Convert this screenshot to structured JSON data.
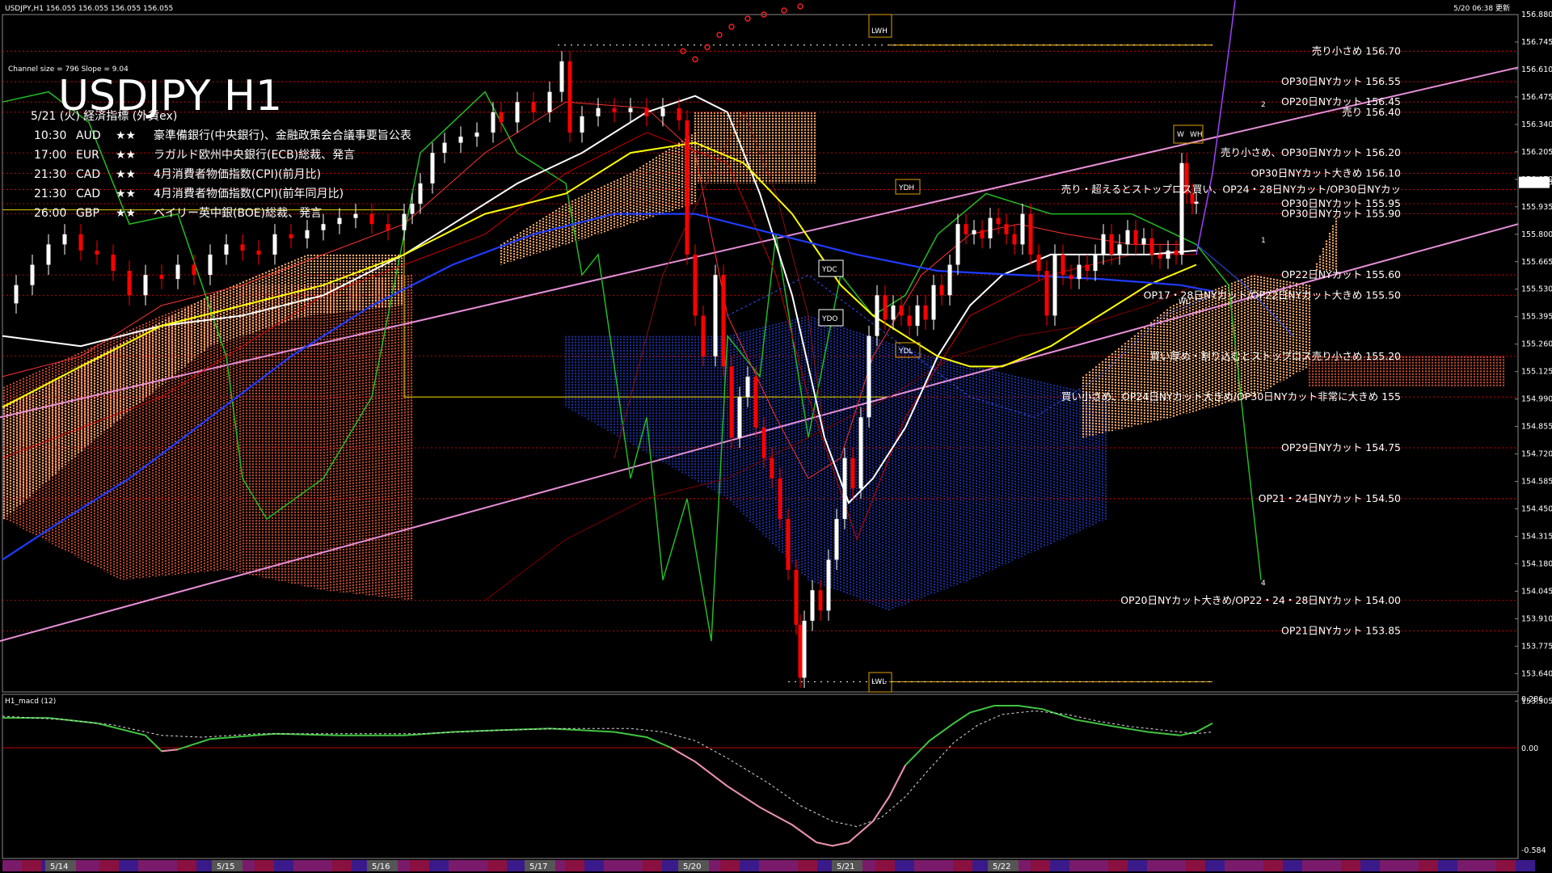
{
  "header": {
    "symbol_info": "USDJPY,H1  156.055 156.055 156.055 156.055",
    "timestamp": "5/20 06:38 更新",
    "channel_info": "Channel size = 796 Slope = 9.04",
    "title": "USDJPY H1"
  },
  "events": {
    "heading": "5/21 (火) 経済指標 (外貨ex)",
    "items": [
      {
        "time": "10:30",
        "currency": "AUD",
        "stars": "★★",
        "text": "豪準備銀行(中央銀行)、金融政策会合議事要旨公表"
      },
      {
        "time": "17:00",
        "currency": "EUR",
        "stars": "★★",
        "text": "ラガルド欧州中央銀行(ECB)総裁、発言"
      },
      {
        "time": "21:30",
        "currency": "CAD",
        "stars": "★★",
        "text": "4月消費者物価指数(CPI)(前月比)"
      },
      {
        "time": "21:30",
        "currency": "CAD",
        "stars": "★★",
        "text": "4月消費者物価指数(CPI)(前年同月比)"
      },
      {
        "time": "26:00",
        "currency": "GBP",
        "stars": "★★",
        "text": "ベイリー英中銀(BOE)総裁、発言"
      }
    ]
  },
  "markers": {
    "lwh": "LWH",
    "lwl": "LWL",
    "ydh": "YDH",
    "ydl": "YDL",
    "ydc": "YDC",
    "ydo": "YDO",
    "wh": "WH",
    "wl": "WL",
    "w": "W",
    "wave_1": "1",
    "wave_2": "2",
    "wave_4": "4"
  },
  "macd": {
    "label": "H1_macd (12)",
    "axis": [
      "0.286",
      "0.00",
      "-0.584"
    ],
    "main_points": [
      [
        3,
        0.17
      ],
      [
        60,
        0.17
      ],
      [
        120,
        0.14
      ],
      [
        180,
        0.07
      ],
      [
        200,
        -0.02
      ],
      [
        220,
        -0.01
      ],
      [
        260,
        0.05
      ],
      [
        340,
        0.08
      ],
      [
        420,
        0.07
      ],
      [
        500,
        0.07
      ],
      [
        560,
        0.09
      ],
      [
        620,
        0.1
      ],
      [
        680,
        0.11
      ],
      [
        760,
        0.09
      ],
      [
        800,
        0.06
      ],
      [
        830,
        0.0
      ],
      [
        860,
        -0.08
      ],
      [
        900,
        -0.22
      ],
      [
        940,
        -0.34
      ],
      [
        980,
        -0.44
      ],
      [
        1010,
        -0.54
      ],
      [
        1030,
        -0.56
      ],
      [
        1050,
        -0.54
      ],
      [
        1080,
        -0.42
      ],
      [
        1100,
        -0.28
      ],
      [
        1120,
        -0.1
      ],
      [
        1150,
        0.04
      ],
      [
        1180,
        0.14
      ],
      [
        1200,
        0.2
      ],
      [
        1230,
        0.24
      ],
      [
        1260,
        0.24
      ],
      [
        1290,
        0.22
      ],
      [
        1330,
        0.16
      ],
      [
        1380,
        0.12
      ],
      [
        1420,
        0.09
      ],
      [
        1460,
        0.07
      ],
      [
        1480,
        0.09
      ],
      [
        1500,
        0.14
      ]
    ],
    "signal_points": [
      [
        3,
        0.18
      ],
      [
        80,
        0.16
      ],
      [
        140,
        0.13
      ],
      [
        200,
        0.07
      ],
      [
        250,
        0.06
      ],
      [
        320,
        0.08
      ],
      [
        420,
        0.08
      ],
      [
        520,
        0.08
      ],
      [
        620,
        0.1
      ],
      [
        700,
        0.11
      ],
      [
        780,
        0.11
      ],
      [
        820,
        0.09
      ],
      [
        860,
        0.04
      ],
      [
        900,
        -0.06
      ],
      [
        950,
        -0.2
      ],
      [
        990,
        -0.33
      ],
      [
        1030,
        -0.42
      ],
      [
        1060,
        -0.45
      ],
      [
        1090,
        -0.4
      ],
      [
        1120,
        -0.28
      ],
      [
        1150,
        -0.12
      ],
      [
        1180,
        0.03
      ],
      [
        1210,
        0.13
      ],
      [
        1240,
        0.19
      ],
      [
        1280,
        0.21
      ],
      [
        1320,
        0.19
      ],
      [
        1360,
        0.15
      ],
      [
        1400,
        0.12
      ],
      [
        1440,
        0.1
      ],
      [
        1480,
        0.08
      ],
      [
        1500,
        0.09
      ]
    ]
  },
  "colors": {
    "background": "#000000",
    "bull": "#ffffff",
    "bear": "#ff0000",
    "cloud_bull": "#ffae6e",
    "cloud_bear": "#c04a30",
    "ma_short": "#ffffff",
    "ma_mid": "#ffff00",
    "ma_long": "#1f3cff",
    "channel": "#e88fd8",
    "chikou": "#22bb22",
    "level": "#ff0000"
  },
  "chart_data": {
    "type": "candlestick",
    "title": "USDJPY H1",
    "ylim": [
      153.55,
      156.88
    ],
    "y_ticks": [
      "156.880",
      "156.745",
      "156.610",
      "156.475",
      "156.340",
      "156.205",
      "156.070",
      "155.935",
      "155.800",
      "155.665",
      "155.530",
      "155.395",
      "155.260",
      "155.125",
      "154.990",
      "154.855",
      "154.720",
      "154.585",
      "154.450",
      "154.315",
      "154.180",
      "154.045",
      "153.910",
      "153.775",
      "153.640",
      "153.505"
    ],
    "current_price": "156.055",
    "x_labels": [
      "5/14",
      "5/15",
      "5/16",
      "5/17",
      "5/20",
      "5/21",
      "5/22"
    ],
    "levels": [
      {
        "label": "売り小さめ 156.70",
        "value": 156.7
      },
      {
        "label": "OP30日NYカット 156.55",
        "value": 156.55
      },
      {
        "label": "OP20日NYカット 156.45",
        "value": 156.45
      },
      {
        "label": "売り 156.40",
        "value": 156.4
      },
      {
        "label": "売り小さめ、OP30日NYカット 156.20",
        "value": 156.2
      },
      {
        "label": "OP30日NYカット大きめ 156.10",
        "value": 156.1
      },
      {
        "label": "売り・超えるとストップロス買い、OP24・28日NYカット/OP30日NYカッ",
        "value": 156.02
      },
      {
        "label": "OP30日NYカット 155.95",
        "value": 155.95
      },
      {
        "label": "OP30日NYカット 155.90",
        "value": 155.9
      },
      {
        "label": "OP22日NYカット 155.60",
        "value": 155.6
      },
      {
        "label": "OP17・28日NYカット/OP22日NYカット大きめ 155.50",
        "value": 155.5
      },
      {
        "label": "買い厚め・割り込むとストップロス売り小さめ 155.20",
        "value": 155.2
      },
      {
        "label": "買い小さめ、OP24日NYカット大きめ/OP30日NYカット非常に大きめ 155",
        "value": 155.0
      },
      {
        "label": "OP29日NYカット 154.75",
        "value": 154.75
      },
      {
        "label": "OP21・24日NYカット 154.50",
        "value": 154.5
      },
      {
        "label": "OP20日NYカット大きめ/OP22・24・28日NYカット 154.00",
        "value": 154.0
      },
      {
        "label": "OP21日NYカット 153.85",
        "value": 153.85
      }
    ],
    "price_path": [
      [
        5,
        155.46
      ],
      [
        20,
        155.55
      ],
      [
        40,
        155.65
      ],
      [
        60,
        155.75
      ],
      [
        80,
        155.8
      ],
      [
        100,
        155.72
      ],
      [
        120,
        155.7
      ],
      [
        140,
        155.62
      ],
      [
        160,
        155.5
      ],
      [
        180,
        155.6
      ],
      [
        200,
        155.58
      ],
      [
        220,
        155.65
      ],
      [
        240,
        155.6
      ],
      [
        260,
        155.7
      ],
      [
        280,
        155.75
      ],
      [
        300,
        155.72
      ],
      [
        320,
        155.7
      ],
      [
        340,
        155.8
      ],
      [
        360,
        155.78
      ],
      [
        380,
        155.82
      ],
      [
        400,
        155.85
      ],
      [
        420,
        155.88
      ],
      [
        440,
        155.9
      ],
      [
        460,
        155.85
      ],
      [
        480,
        155.82
      ],
      [
        500,
        155.9
      ],
      [
        510,
        155.95
      ],
      [
        520,
        156.05
      ],
      [
        535,
        156.2
      ],
      [
        550,
        156.25
      ],
      [
        570,
        156.28
      ],
      [
        590,
        156.3
      ],
      [
        610,
        156.4
      ],
      [
        620,
        156.35
      ],
      [
        640,
        156.45
      ],
      [
        660,
        156.4
      ],
      [
        680,
        156.5
      ],
      [
        695,
        156.65
      ],
      [
        705,
        156.3
      ],
      [
        720,
        156.38
      ],
      [
        740,
        156.42
      ],
      [
        760,
        156.4
      ],
      [
        780,
        156.42
      ],
      [
        800,
        156.38
      ],
      [
        820,
        156.42
      ],
      [
        840,
        156.36
      ],
      [
        850,
        155.7
      ],
      [
        860,
        155.4
      ],
      [
        870,
        155.2
      ],
      [
        885,
        155.6
      ],
      [
        895,
        155.15
      ],
      [
        905,
        154.8
      ],
      [
        915,
        155.0
      ],
      [
        925,
        155.1
      ],
      [
        935,
        154.85
      ],
      [
        945,
        154.7
      ],
      [
        955,
        154.6
      ],
      [
        965,
        154.4
      ],
      [
        975,
        154.15
      ],
      [
        985,
        153.88
      ],
      [
        990,
        153.62
      ],
      [
        995,
        153.9
      ],
      [
        1005,
        154.05
      ],
      [
        1015,
        153.95
      ],
      [
        1025,
        154.2
      ],
      [
        1035,
        154.4
      ],
      [
        1045,
        154.7
      ],
      [
        1055,
        154.55
      ],
      [
        1065,
        154.9
      ],
      [
        1075,
        155.3
      ],
      [
        1085,
        155.5
      ],
      [
        1095,
        155.38
      ],
      [
        1105,
        155.45
      ],
      [
        1115,
        155.4
      ],
      [
        1125,
        155.35
      ],
      [
        1135,
        155.45
      ],
      [
        1145,
        155.38
      ],
      [
        1155,
        155.55
      ],
      [
        1165,
        155.5
      ],
      [
        1175,
        155.65
      ],
      [
        1185,
        155.85
      ],
      [
        1195,
        155.8
      ],
      [
        1205,
        155.82
      ],
      [
        1215,
        155.78
      ],
      [
        1225,
        155.88
      ],
      [
        1235,
        155.85
      ],
      [
        1245,
        155.8
      ],
      [
        1255,
        155.75
      ],
      [
        1265,
        155.9
      ],
      [
        1275,
        155.7
      ],
      [
        1285,
        155.62
      ],
      [
        1295,
        155.4
      ],
      [
        1305,
        155.7
      ],
      [
        1315,
        155.6
      ],
      [
        1325,
        155.58
      ],
      [
        1335,
        155.65
      ],
      [
        1345,
        155.62
      ],
      [
        1355,
        155.7
      ],
      [
        1365,
        155.8
      ],
      [
        1375,
        155.7
      ],
      [
        1385,
        155.75
      ],
      [
        1395,
        155.82
      ],
      [
        1405,
        155.75
      ],
      [
        1415,
        155.78
      ],
      [
        1425,
        155.7
      ],
      [
        1435,
        155.68
      ],
      [
        1445,
        155.72
      ],
      [
        1455,
        155.7
      ],
      [
        1462,
        156.15
      ],
      [
        1468,
        156.0
      ],
      [
        1475,
        155.95
      ],
      [
        1480,
        155.96
      ]
    ]
  }
}
